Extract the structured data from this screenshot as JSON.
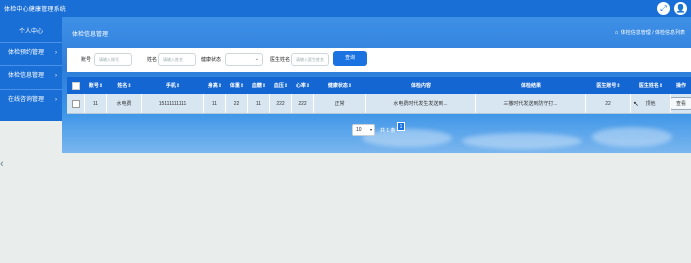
{
  "app": {
    "title": "体检中心健康管理系统"
  },
  "topbar_icons": {
    "expand": "expand-icon",
    "user": "user-avatar-icon"
  },
  "sidebar": {
    "items": [
      {
        "label": "个人中心",
        "chevron": ""
      },
      {
        "label": "体检预约管理",
        "chevron": "›"
      },
      {
        "label": "体检信息管理",
        "chevron": "›"
      },
      {
        "label": "在线咨询管理",
        "chevron": "›"
      }
    ]
  },
  "header": {
    "title": "体检信息管理",
    "breadcrumb": [
      "体检信息管理",
      "体检信息列表"
    ],
    "breadcrumb_sep": "/",
    "home_icon": "⌂"
  },
  "search": {
    "fields": [
      {
        "label": "账号",
        "placeholder": "请输入账号"
      },
      {
        "label": "姓名",
        "placeholder": "请输入姓名"
      },
      {
        "label": "健康状态",
        "value": ""
      },
      {
        "label": "医生姓名",
        "placeholder": "请输入医生姓名"
      }
    ],
    "button": "查询"
  },
  "table": {
    "columns": [
      "账号",
      "姓名",
      "手机",
      "身高",
      "体重",
      "血糖",
      "血压",
      "心率",
      "健康状态",
      "体检内容",
      "体检结果",
      "医生账号",
      "医生姓名",
      "操作"
    ],
    "sort_icon": "⇕",
    "rows": [
      {
        "account": "11",
        "name": "水电费",
        "phone": "15111111111",
        "height": "11",
        "weight": "22",
        "blood_sugar": "11",
        "blood_pressure": "222",
        "heart_rate": "222",
        "health_status": "正常",
        "exam_content": "水电费时代发生发送到...",
        "exam_result": "三撒时代发送到防守打...",
        "doctor_account": "22",
        "doctor_name": "顶他",
        "action": "查看"
      }
    ]
  },
  "pagination": {
    "page_size": "10",
    "total": "共 1 条",
    "current_page": "1"
  },
  "colors": {
    "primary": "#1a6fd6",
    "table_header": "#1466d2",
    "row_bg": "#d8e6f2",
    "page_bg": "#e9eeec"
  }
}
